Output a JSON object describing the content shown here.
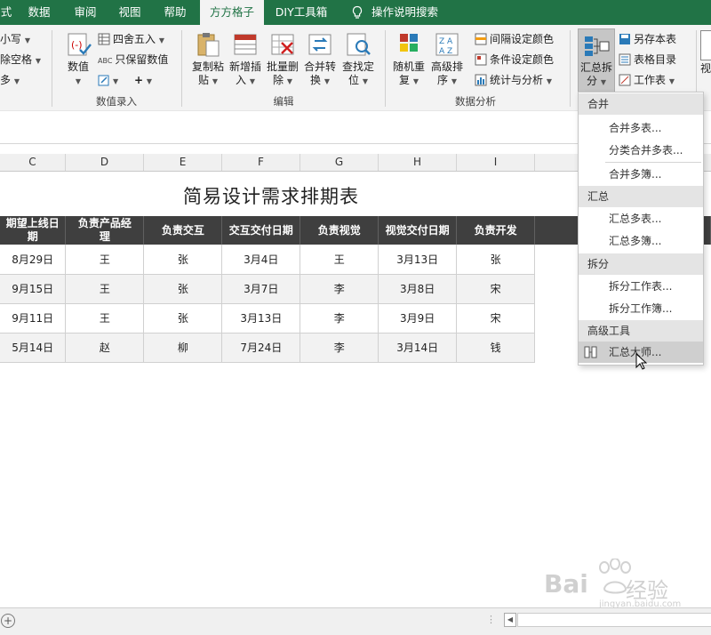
{
  "tabs": [
    "式",
    "数据",
    "审阅",
    "视图",
    "帮助",
    "方方格子",
    "DIY工具箱",
    "操作说明搜索"
  ],
  "active_tab": "方方格子",
  "ribbon": {
    "left_partial": [
      "小写",
      "除空格",
      "多"
    ],
    "group_data_entry": {
      "label": "数值录入",
      "big_button": "数值",
      "round_label": "四舍五入",
      "keep_value_label": "只保留数值",
      "abc_text": "ABC"
    },
    "group_edit": {
      "label": "编辑",
      "buttons": [
        {
          "line1": "复制粘",
          "line2": "贴"
        },
        {
          "line1": "新增插",
          "line2": "入"
        },
        {
          "line1": "批量删",
          "line2": "除"
        },
        {
          "line1": "合并转",
          "line2": "换"
        },
        {
          "line1": "查找定",
          "line2": "位"
        }
      ]
    },
    "group_analysis": {
      "label": "数据分析",
      "buttons": [
        {
          "line1": "随机重",
          "line2": "复"
        },
        {
          "line1": "高级排",
          "line2": "序"
        }
      ],
      "small": [
        "间隔设定颜色",
        "条件设定颜色",
        "统计与分析"
      ]
    },
    "group_summary": {
      "button": {
        "line1": "汇总拆",
        "line2": "分"
      },
      "small": [
        "另存本表",
        "表格目录",
        "工作表"
      ]
    },
    "right_partial": "视"
  },
  "columns": [
    "C",
    "D",
    "E",
    "F",
    "G",
    "H",
    "I"
  ],
  "sheet_title": "简易设计需求排期表",
  "table": {
    "headers": [
      {
        "l1": "期望上线日",
        "l2": "期"
      },
      {
        "l1": "负责产品经",
        "l2": "理"
      },
      {
        "l1": "负责交互",
        "l2": ""
      },
      {
        "l1": "交互交付日期",
        "l2": ""
      },
      {
        "l1": "负责视觉",
        "l2": ""
      },
      {
        "l1": "视觉交付日期",
        "l2": ""
      },
      {
        "l1": "负责开发",
        "l2": ""
      }
    ],
    "rows": [
      [
        "8月29日",
        "王",
        "张",
        "3月4日",
        "王",
        "3月13日",
        "张"
      ],
      [
        "9月15日",
        "王",
        "张",
        "3月7日",
        "李",
        "3月8日",
        "宋"
      ],
      [
        "9月11日",
        "王",
        "张",
        "3月13日",
        "李",
        "3月9日",
        "宋"
      ],
      [
        "5月14日",
        "赵",
        "柳",
        "7月24日",
        "李",
        "3月14日",
        "钱"
      ]
    ]
  },
  "dropdown": {
    "sections": [
      {
        "header": "合并",
        "items": [
          "合并多表...",
          "分类合并多表...",
          "合并多簿..."
        ]
      },
      {
        "header": "汇总",
        "items": [
          "汇总多表...",
          "汇总多簿..."
        ]
      },
      {
        "header": "拆分",
        "items": [
          "拆分工作表...",
          "拆分工作簿..."
        ]
      },
      {
        "header": "高级工具",
        "items": [
          "汇总大师..."
        ]
      }
    ],
    "hovered_item": "汇总大师..."
  },
  "watermark": {
    "brand": "Bai",
    "brand2": "经验",
    "url": "jingyan.baidu.com"
  },
  "colors": {
    "ribbon_green": "#217346",
    "header_dark": "#3f3f3f",
    "hover_gray": "#cfcfcf"
  }
}
